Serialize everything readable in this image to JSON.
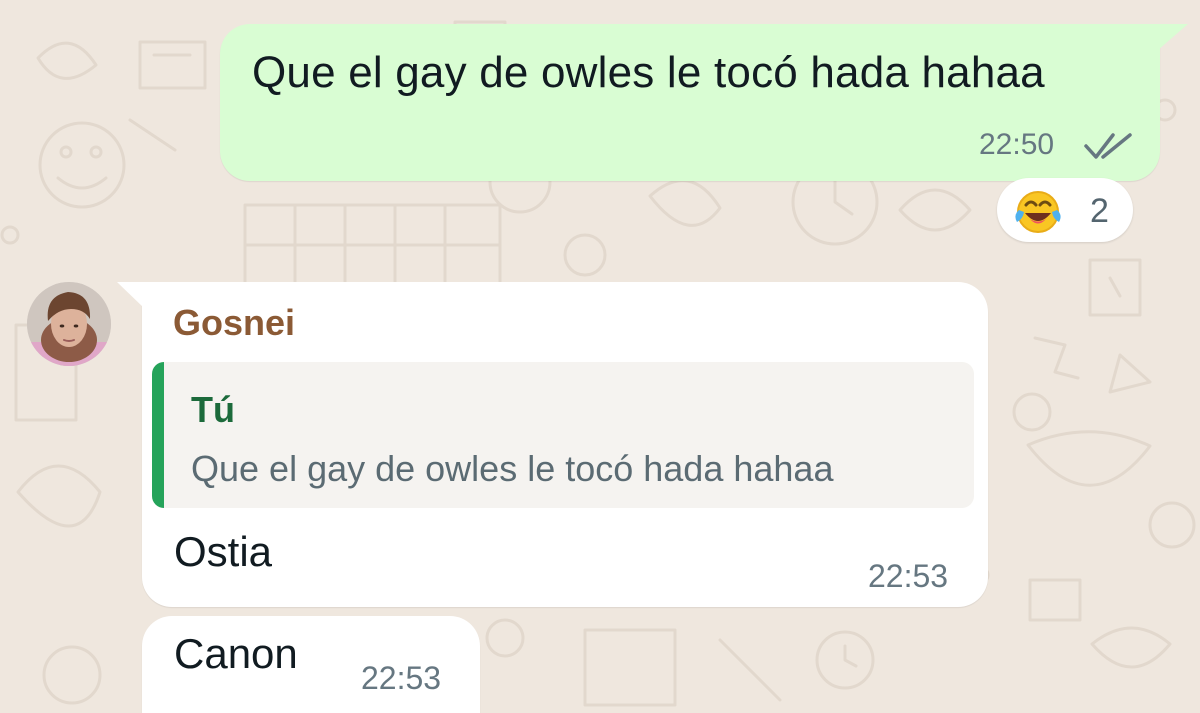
{
  "theme": {
    "background": "#efe7de",
    "outgoing_bubble": "#d9fdd3",
    "incoming_bubble": "#ffffff",
    "read_receipt_color": "#667781",
    "sender_color": "#8b5a35",
    "quote_bar_color": "#25a35a",
    "quote_author_color": "#1c6a3b"
  },
  "messages": [
    {
      "direction": "outgoing",
      "text": "Que el gay de owles le tocó hada hahaa",
      "time": "22:50",
      "status_icon": "double-check-icon",
      "reaction": {
        "emoji_icon": "face-with-tears-of-joy-icon",
        "count": "2"
      }
    },
    {
      "direction": "incoming",
      "sender": "Gosnei",
      "avatar_icon": "avatar",
      "quoted": {
        "author": "Tú",
        "text": "Que el gay de owles le tocó hada hahaa"
      },
      "text": "Ostia",
      "time": "22:53"
    },
    {
      "direction": "incoming",
      "text": "Canon",
      "time": "22:53"
    }
  ]
}
